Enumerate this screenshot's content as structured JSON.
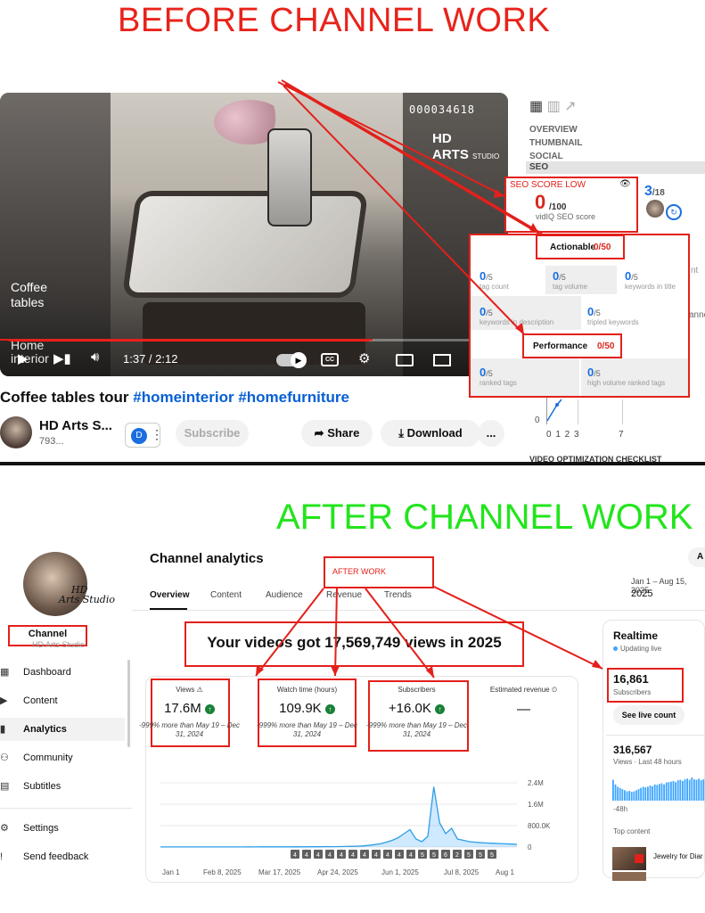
{
  "headers": {
    "before": "BEFORE CHANNEL WORK",
    "after": "AFTER CHANNEL WORK"
  },
  "colors": {
    "annotation_red": "#e3201b",
    "before_header": "#e8231b",
    "after_header": "#22e51c",
    "vidiq_blue": "#1a6ee0",
    "youtube_red": "#ff1a1a"
  },
  "video": {
    "counter": "000034618",
    "brand_line1": "HD",
    "brand_line2": "ARTS",
    "brand_line3": "STUDIO",
    "caption_line1": "Coffee",
    "caption_line2": "tables",
    "caption_faded_line1": "Home",
    "caption_faded_line2": "interior",
    "time": "1:37 / 2:12",
    "progress": 0.735,
    "title_plain": "Coffee tables tour ",
    "title_tags": "#homeinterior #homefurniture",
    "channel_name": "HD Arts S...",
    "channel_subs": "793...",
    "vidiq_badge": "D",
    "subscribe": "Subscribe",
    "share": "Share",
    "download": "Download",
    "more": "..."
  },
  "vidiq": {
    "tabs": [
      "OVERVIEW",
      "THUMBNAIL",
      "SOCIAL"
    ],
    "section": "SEO",
    "seo_label": "SEO SCORE LOW",
    "seo_score": "0",
    "seo_max": "/100",
    "seo_sub": "vidIQ SEO score",
    "side_score": "3",
    "side_max": "/18",
    "cut_text_1": "nt",
    "cut_text_2": "anne",
    "actionable_label": "Actionable",
    "actionable_score": "0/50",
    "actionable_metrics": [
      {
        "value": "0",
        "max": "/5",
        "label": "tag count"
      },
      {
        "value": "0",
        "max": "/5",
        "label": "tag volume"
      },
      {
        "value": "0",
        "max": "/5",
        "label": "keywords in title"
      },
      {
        "value": "0",
        "max": "/5",
        "label": "keywords in description"
      },
      {
        "value": "0",
        "max": "/5",
        "label": "tripled keywords"
      }
    ],
    "performance_label": "Performance",
    "performance_score": "0/50",
    "performance_metrics": [
      {
        "value": "0",
        "max": "/5",
        "label": "ranked tags"
      },
      {
        "value": "0",
        "max": "/5",
        "label": "high volume ranked tags"
      }
    ],
    "mini_zero": "0",
    "mini_ticks": "0 1 2 3",
    "mini_tick_7": "7",
    "checklist": "VIDEO OPTIMIZATION CHECKLIST"
  },
  "analytics": {
    "title": "Channel analytics",
    "tabs": [
      "Overview",
      "Content",
      "Audience",
      "Revenue",
      "Trends"
    ],
    "date_range": "Jan 1 – Aug 15, 2025",
    "year": "2025",
    "cut_button": "A",
    "after_work_label": "AFTER WORK",
    "headline": "Your videos got 17,569,749 views in 2025",
    "channel_label": "Channel",
    "channel_sub": "HD Arts Studio",
    "logo_line1": "HD",
    "logo_line2": "Arts Studio",
    "nav": [
      {
        "icon": "dashboard-icon",
        "glyph": "▦",
        "label": "Dashboard"
      },
      {
        "icon": "content-icon",
        "glyph": "▶",
        "label": "Content"
      },
      {
        "icon": "analytics-icon",
        "glyph": "▮",
        "label": "Analytics",
        "active": true
      },
      {
        "icon": "community-icon",
        "glyph": "⚇",
        "label": "Community"
      },
      {
        "icon": "subtitles-icon",
        "glyph": "▤",
        "label": "Subtitles"
      }
    ],
    "nav_bottom": [
      {
        "icon": "settings-icon",
        "glyph": "⚙",
        "label": "Settings"
      },
      {
        "icon": "feedback-icon",
        "glyph": "!",
        "label": "Send feedback"
      }
    ],
    "kpis": [
      {
        "label": "Views ⚠",
        "value": "17.6M",
        "compare": "-999% more than May 19 – Dec 31, 2024"
      },
      {
        "label": "Watch time (hours)",
        "value": "109.9K",
        "compare": "-999% more than May 19 – Dec 31, 2024"
      },
      {
        "label": "Subscribers",
        "value": "+16.0K",
        "compare": "-999% more than May 19 – Dec 31, 2024"
      },
      {
        "label": "Estimated revenue",
        "value": "—",
        "compare": ""
      }
    ],
    "realtime": {
      "title": "Realtime",
      "live": "Updating live",
      "subscribers": "16,861",
      "subscribers_label": "Subscribers",
      "live_button": "See live count",
      "views": "316,567",
      "views_label": "Views · Last 48 hours",
      "axis_label": "-48h",
      "top_content": "Top content",
      "top_item": "Jewelry for Diar"
    }
  },
  "chart_data": {
    "type": "area",
    "title": "",
    "xlabel": "",
    "ylabel": "",
    "x_tick_labels": [
      "Jan 1",
      "Feb 8, 2025",
      "Mar 17, 2025",
      "Apr 24, 2025",
      "Jun 1, 2025",
      "Jul 8, 2025",
      "Aug 1"
    ],
    "y_tick_labels": [
      "2.4M",
      "1.6M",
      "800.0K",
      "0"
    ],
    "ylim": [
      0,
      2400000
    ],
    "marker_labels": [
      "4",
      "4",
      "4",
      "4",
      "4",
      "4",
      "4",
      "4",
      "4",
      "4",
      "4",
      "5",
      "5",
      "6",
      "2",
      "5",
      "5",
      "5"
    ],
    "grid": true,
    "series": [
      {
        "values": [
          2000,
          2000,
          2500,
          2000,
          3000,
          2500,
          2000,
          3000,
          2500,
          3000,
          3500,
          3000,
          4000,
          3500,
          4000,
          5000,
          4000,
          6000,
          5000,
          7000,
          6000,
          8000,
          7000,
          9000,
          8000,
          10000,
          12000,
          11000,
          15000,
          14000,
          18000,
          20000,
          25000,
          30000,
          40000,
          60000,
          90000,
          120000,
          180000,
          250000,
          350000,
          500000,
          650000,
          300000,
          200000,
          400000,
          2250000,
          900000,
          500000,
          700000,
          300000,
          250000,
          200000,
          180000,
          160000,
          150000,
          140000,
          130000,
          120000,
          110000,
          100000
        ]
      }
    ],
    "realtime_bars": [
      0.9,
      0.7,
      0.6,
      0.55,
      0.5,
      0.45,
      0.4,
      0.42,
      0.38,
      0.4,
      0.45,
      0.5,
      0.55,
      0.6,
      0.58,
      0.6,
      0.65,
      0.62,
      0.7,
      0.68,
      0.72,
      0.75,
      0.7,
      0.78,
      0.8,
      0.82,
      0.85,
      0.8,
      0.88,
      0.9,
      0.85,
      0.92,
      0.95,
      0.9,
      1.0,
      0.92,
      0.9,
      0.95,
      0.88,
      0.92
    ]
  }
}
